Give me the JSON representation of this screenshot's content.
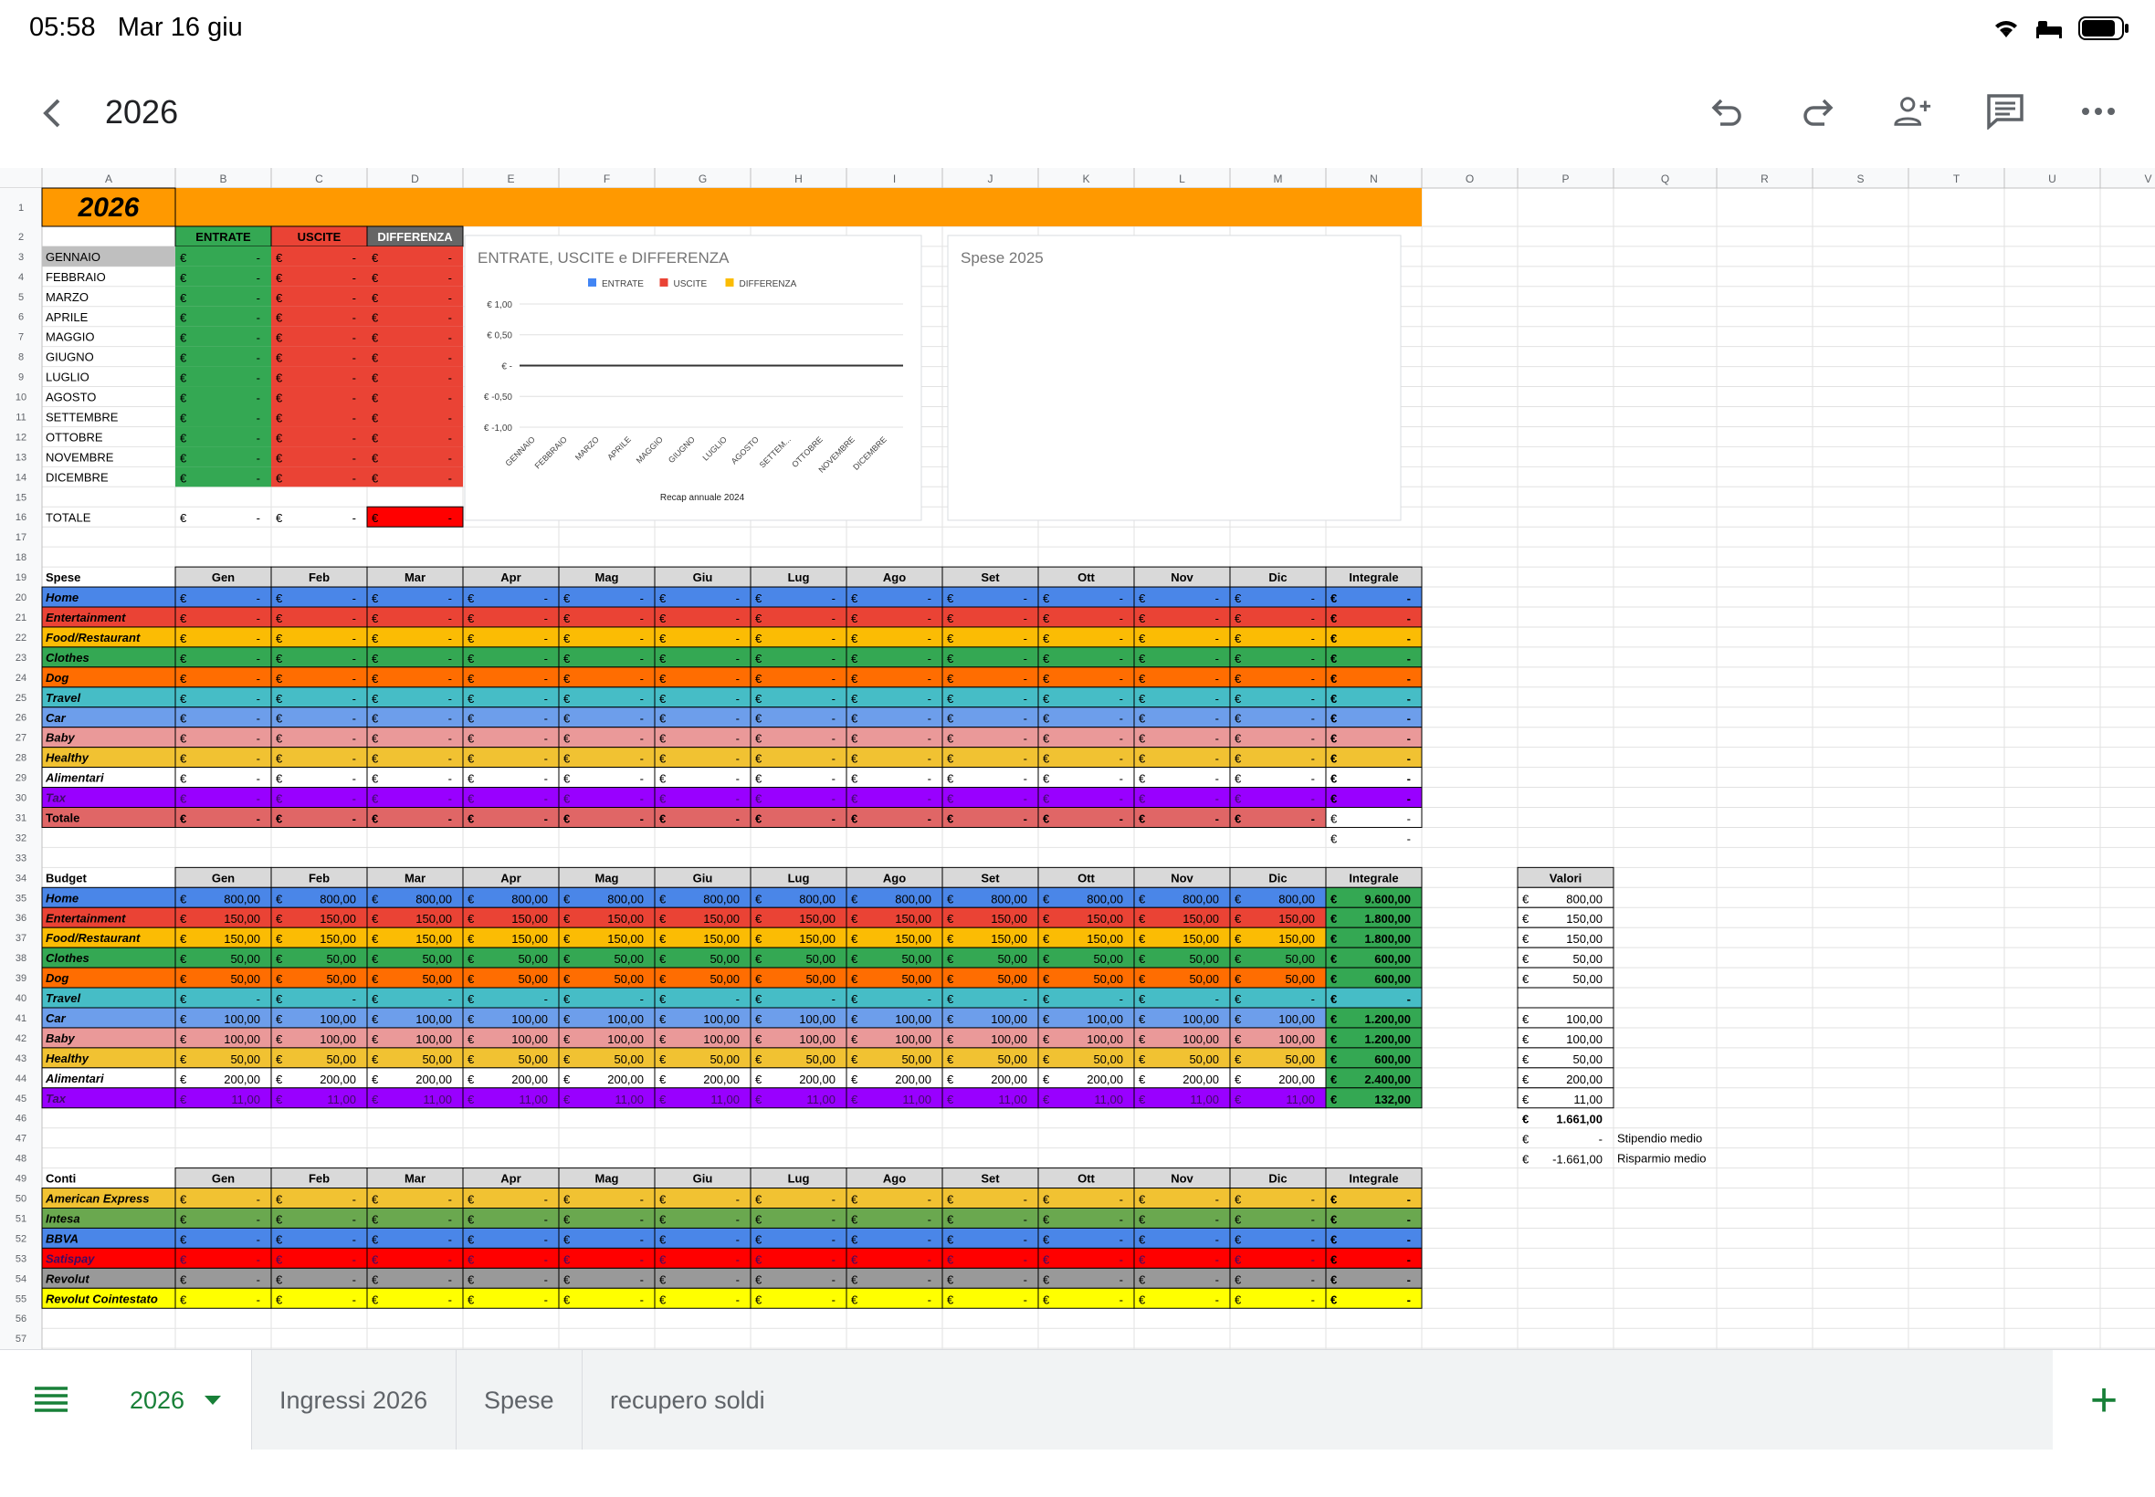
{
  "status": {
    "time": "05:58",
    "date": "Mar 16 giu"
  },
  "toolbar": {
    "title": "2026"
  },
  "tabs": {
    "active": "2026",
    "items": [
      "Ingressi 2026",
      "Spese",
      "recupero soldi"
    ]
  },
  "colors": {
    "orange": "#ff9900",
    "green": "#34a853",
    "red": "#ea4335",
    "blue": "#4a86e8",
    "yellow": "#fbbc04",
    "teal": "#46bdc6",
    "violet": "#9900ff",
    "pink": "#ea9999",
    "grey": "#999999",
    "brightyellow": "#ffff00",
    "brightred": "#ff0000",
    "darkgreen": "#6aa84f",
    "gold": "#f1c232",
    "ltblue": "#6d9eeb",
    "deeporange": "#ff6d01",
    "header": "#d9d9d9"
  },
  "grid": {
    "columns": [
      "A",
      "B",
      "C",
      "D",
      "E",
      "F",
      "G",
      "H",
      "I",
      "J",
      "K",
      "L",
      "M",
      "N",
      "O",
      "P",
      "Q",
      "R",
      "S",
      "T",
      "U",
      "V"
    ],
    "year": "2026",
    "summary_headers": [
      "ENTRATE",
      "USCITE",
      "DIFFERENZA"
    ],
    "months": [
      "GENNAIO",
      "FEBBRAIO",
      "MARZO",
      "APRILE",
      "MAGGIO",
      "GIUGNO",
      "LUGLIO",
      "AGOSTO",
      "SETTEMBRE",
      "OTTOBRE",
      "NOVEMBRE",
      "DICEMBRE"
    ],
    "totale_label": "TOTALE",
    "month_short": [
      "Gen",
      "Feb",
      "Mar",
      "Apr",
      "Mag",
      "Giu",
      "Lug",
      "Ago",
      "Set",
      "Ott",
      "Nov",
      "Dic"
    ],
    "integrale": "Integrale",
    "spese_title": "Spese",
    "categories": [
      "Home",
      "Entertainment",
      "Food/Restaurant",
      "Clothes",
      "Dog",
      "Travel",
      "Car",
      "Baby",
      "Healthy",
      "Alimentari",
      "Tax"
    ],
    "totale_row": "Totale",
    "budget_title": "Budget",
    "budget_monthly": [
      "800,00",
      "150,00",
      "150,00",
      "50,00",
      "50,00",
      "-",
      "100,00",
      "100,00",
      "50,00",
      "200,00",
      "11,00"
    ],
    "budget_integrale": [
      "9.600,00",
      "1.800,00",
      "1.800,00",
      "600,00",
      "600,00",
      "-",
      "1.200,00",
      "1.200,00",
      "600,00",
      "2.400,00",
      "132,00"
    ],
    "valori_title": "Valori",
    "valori": [
      "800,00",
      "150,00",
      "150,00",
      "50,00",
      "50,00",
      "",
      "100,00",
      "100,00",
      "50,00",
      "200,00",
      "11,00"
    ],
    "valori_total": "1.661,00",
    "stipendio_value": "-",
    "stipendio_label": "Stipendio medio",
    "risparmio_value": "-1.661,00",
    "risparmio_label": "Risparmio medio",
    "conti_title": "Conti",
    "conti": [
      "American Express",
      "Intesa",
      "BBVA",
      "Satispay",
      "Revolut",
      "Revolut Cointestato"
    ],
    "euro": "€",
    "dash": "-"
  },
  "chart_data": [
    {
      "type": "line",
      "title": "ENTRATE, USCITE e DIFFERENZA",
      "subtitle": "Recap annuale 2024",
      "legend": "top",
      "categories": [
        "GENNAIO",
        "FEBBRAIO",
        "MARZO",
        "APRILE",
        "MAGGIO",
        "GIUGNO",
        "LUGLIO",
        "AGOSTO",
        "SETTEM...",
        "OTTOBRE",
        "NOVEMBRE",
        "DICEMBRE"
      ],
      "series": [
        {
          "name": "ENTRATE",
          "color": "#4285f4",
          "values": [
            0,
            0,
            0,
            0,
            0,
            0,
            0,
            0,
            0,
            0,
            0,
            0
          ]
        },
        {
          "name": "USCITE",
          "color": "#ea4335",
          "values": [
            0,
            0,
            0,
            0,
            0,
            0,
            0,
            0,
            0,
            0,
            0,
            0
          ]
        },
        {
          "name": "DIFFERENZA",
          "color": "#fbbc04",
          "values": [
            0,
            0,
            0,
            0,
            0,
            0,
            0,
            0,
            0,
            0,
            0,
            0
          ]
        }
      ],
      "yticks": [
        "€ 1,00",
        "€ 0,50",
        "€ -",
        "€ -0,50",
        "€ -1,00"
      ],
      "ylim": [
        -1,
        1
      ]
    },
    {
      "type": "pie",
      "title": "Spese 2025",
      "values": []
    }
  ]
}
